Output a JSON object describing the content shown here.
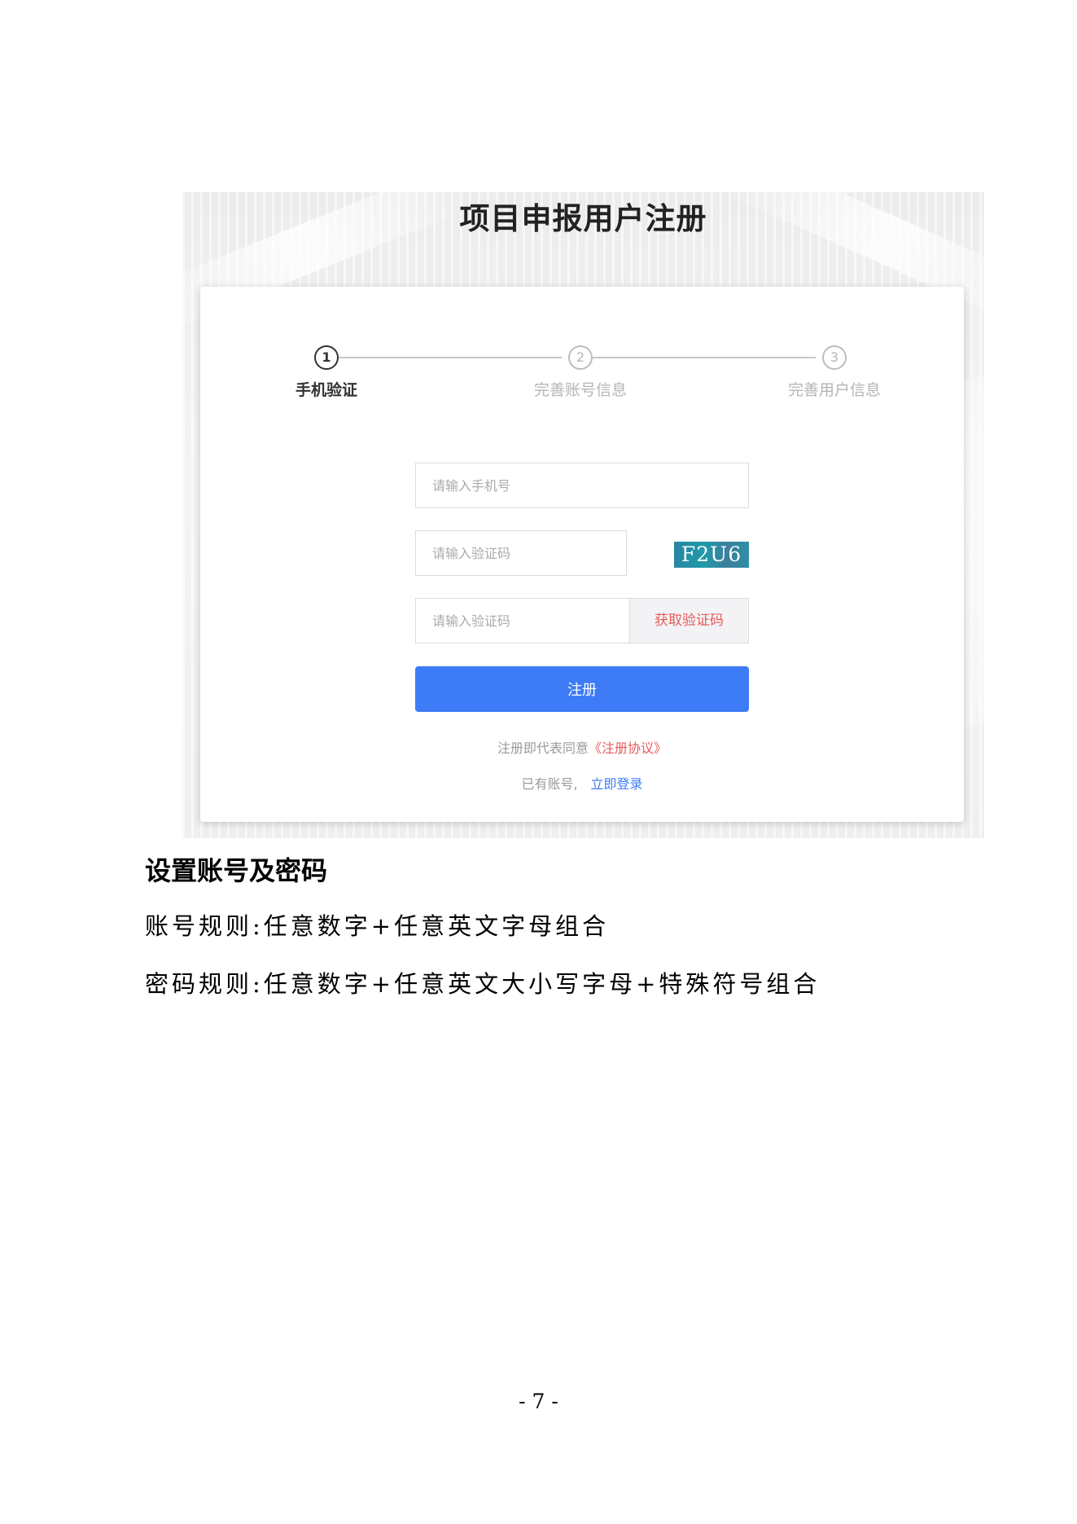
{
  "screenshot": {
    "title": "项目申报用户注册",
    "steps": [
      {
        "number": "1",
        "label": "手机验证",
        "active": true
      },
      {
        "number": "2",
        "label": "完善账号信息",
        "active": false
      },
      {
        "number": "3",
        "label": "完善用户信息",
        "active": false
      }
    ],
    "form": {
      "phone_placeholder": "请输入手机号",
      "captcha_placeholder": "请输入验证码",
      "captcha_image_text": "F2U6",
      "sms_placeholder": "请输入验证码",
      "sms_button": "获取验证码",
      "register_button": "注册",
      "agreement_prefix": "注册即代表同意",
      "agreement_link": "《注册协议》",
      "login_prefix": "已有账号,",
      "login_link": "立即登录"
    }
  },
  "document": {
    "heading": "设置账号及密码",
    "paragraphs": [
      "账号规则:任意数字+任意英文字母组合",
      "密码规则:任意数字+任意英文大小写字母+特殊符号组合"
    ],
    "page_number": "- 7 -"
  }
}
